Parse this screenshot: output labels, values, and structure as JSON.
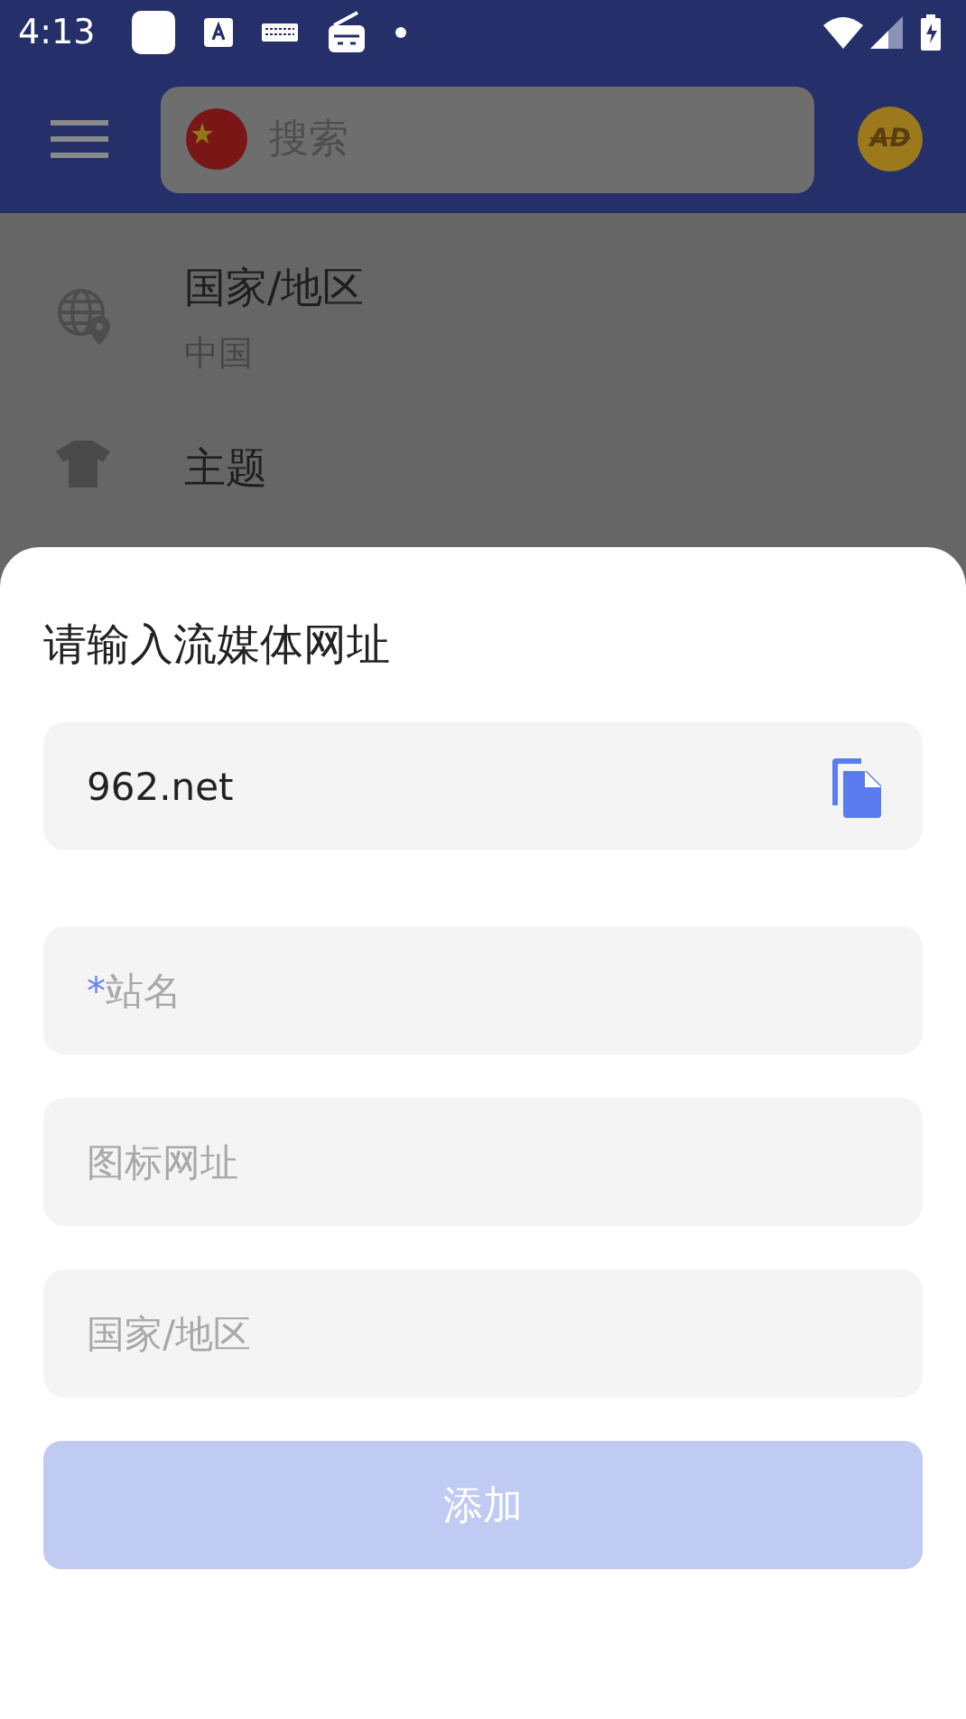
{
  "status_bar": {
    "time": "4:13"
  },
  "header": {
    "search": {
      "placeholder": "搜索"
    },
    "ad_badge": "AD"
  },
  "settings": [
    {
      "kind": "region",
      "title": "国家/地区",
      "value": "中国"
    },
    {
      "kind": "theme",
      "title": "主题"
    }
  ],
  "dialog": {
    "title": "请输入流媒体网址",
    "fields": [
      {
        "value": "962.net",
        "paste_button": true
      },
      {
        "placeholder": "站名",
        "required_mark": "*"
      },
      {
        "placeholder": "图标网址"
      },
      {
        "placeholder": "国家/地区"
      }
    ],
    "add_button": {
      "label": "添加",
      "disabled": true
    }
  }
}
